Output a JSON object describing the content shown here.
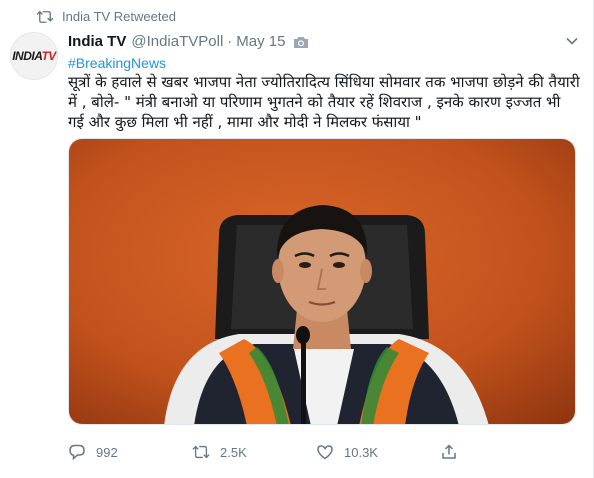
{
  "retweet_notice": {
    "text": "India TV Retweeted"
  },
  "author": {
    "name": "India TV",
    "handle": "@IndiaTVPoll",
    "separator": "·",
    "date": "May 15",
    "avatar_logo_main": "INDIA",
    "avatar_logo_accent": "TV"
  },
  "tweet": {
    "hashtag": "#BreakingNews",
    "text": "सूत्रों के हवाले से खबर भाजपा नेता ज्योतिरादित्य सिंधिया सोमवार तक भाजपा छोड़ने की तैयारी में , बोले- \" मंत्री बनाओ या परिणाम भुगतने को तैयार रहें शिवराज , इनके कारण इज्जत भी गई और कुछ मिला भी नहीं , मामा और मोदी ने मिलकर फंसाया \""
  },
  "actions": {
    "replies": "992",
    "retweets": "2.5K",
    "likes": "10.3K"
  },
  "colors": {
    "link_blue": "#1b95e0",
    "muted_gray": "#657786",
    "saffron": "#e9711f",
    "background_orange": "#c85a1f"
  },
  "icons": {
    "retweet_notice": "retweet-icon",
    "media_badge": "camera-icon",
    "menu": "chevron-down-icon",
    "reply": "reply-icon",
    "retweet": "retweet-icon",
    "like": "heart-icon",
    "share": "share-icon"
  }
}
